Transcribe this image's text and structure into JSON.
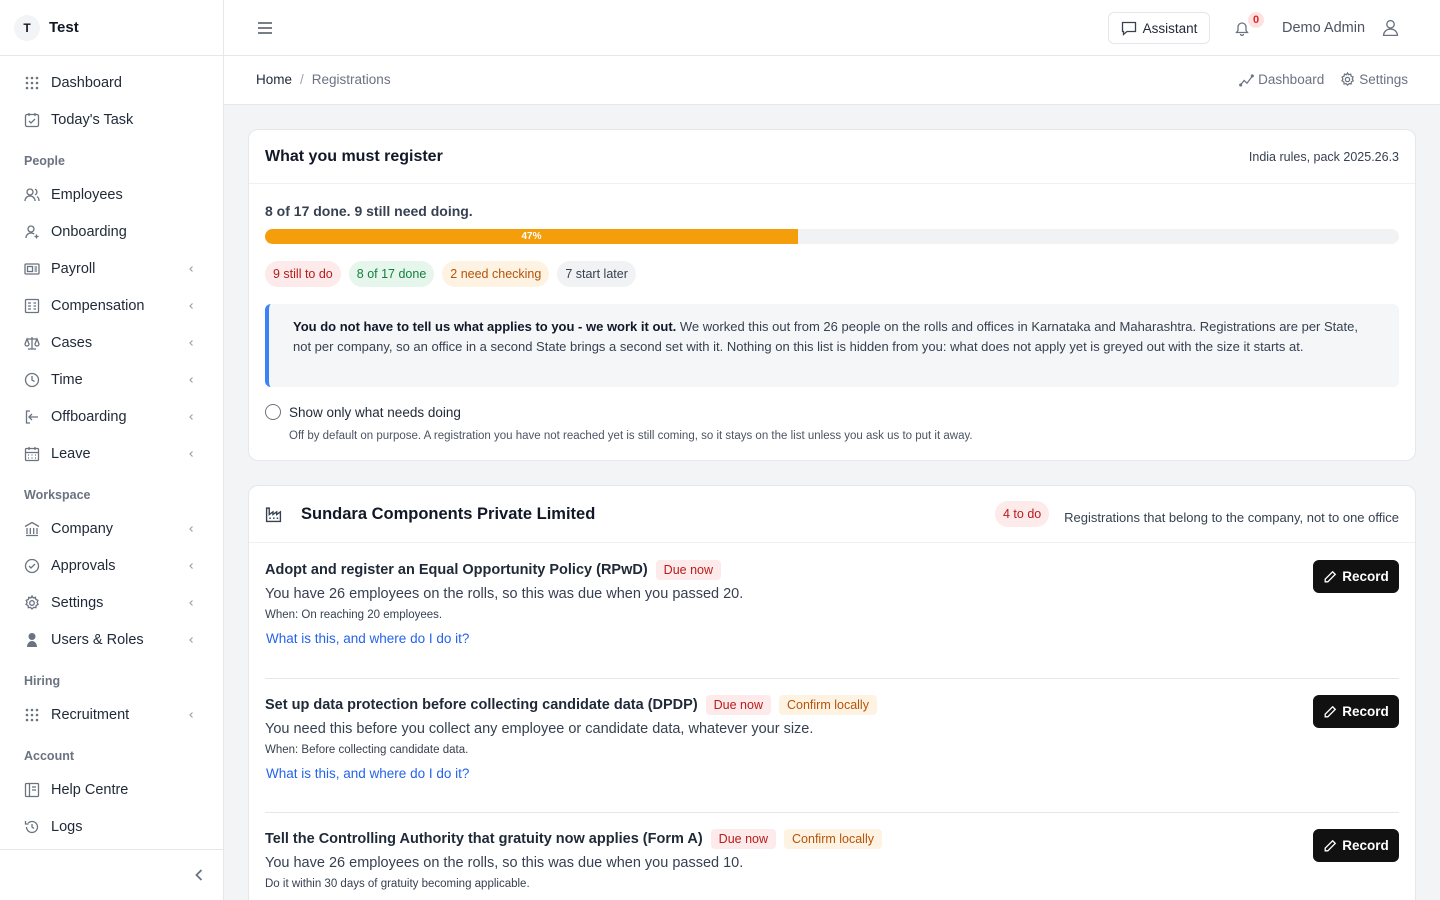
{
  "brand": {
    "initial": "T",
    "name": "Test"
  },
  "sidebar": {
    "items": [
      {
        "label": "Dashboard",
        "icon": "grid-icon"
      },
      {
        "label": "Today's Task",
        "icon": "calendar-check-icon"
      }
    ],
    "sections": [
      {
        "title": "People",
        "items": [
          {
            "label": "Employees",
            "icon": "users-icon"
          },
          {
            "label": "Onboarding",
            "icon": "user-plus-icon"
          },
          {
            "label": "Payroll",
            "icon": "payroll-icon"
          },
          {
            "label": "Compensation",
            "icon": "compensation-icon"
          },
          {
            "label": "Cases",
            "icon": "scale-icon"
          },
          {
            "label": "Time",
            "icon": "clock-icon"
          },
          {
            "label": "Offboarding",
            "icon": "logout-icon"
          },
          {
            "label": "Leave",
            "icon": "calendar-icon"
          }
        ]
      },
      {
        "title": "Workspace",
        "items": [
          {
            "label": "Company",
            "icon": "building-icon"
          },
          {
            "label": "Approvals",
            "icon": "check-circle-icon"
          },
          {
            "label": "Settings",
            "icon": "gear-icon"
          },
          {
            "label": "Users & Roles",
            "icon": "user-shield-icon"
          }
        ]
      },
      {
        "title": "Hiring",
        "items": [
          {
            "label": "Recruitment",
            "icon": "grid-icon"
          }
        ]
      },
      {
        "title": "Account",
        "items": [
          {
            "label": "Help Centre",
            "icon": "help-book-icon"
          },
          {
            "label": "Logs",
            "icon": "history-icon"
          }
        ]
      }
    ]
  },
  "topbar": {
    "assistant_label": "Assistant",
    "notification_count": "0",
    "user_name": "Demo Admin"
  },
  "breadcrumb": {
    "home": "Home",
    "separator": "/",
    "current": "Registrations",
    "actions": {
      "dashboard": "Dashboard",
      "settings": "Settings"
    }
  },
  "overview": {
    "title": "What you must register",
    "meta": "India rules, pack 2025.26.3",
    "summary": "8 of 17 done. 9 still need doing.",
    "progress": {
      "percent": 47,
      "label": "47%"
    },
    "pills": {
      "todo": "9 still to do",
      "done": "8 of 17 done",
      "check": "2 need checking",
      "later": "7 start later"
    },
    "callout": {
      "bold": "You do not have to tell us what applies to you - we work it out.",
      "text": " We worked this out from 26 people on the rolls and offices in Karnataka and Maharashtra. Registrations are per State, not per company, so an office in a second State brings a second set with it. Nothing on this list is hidden from you: what does not apply yet is greyed out with the size it starts at."
    },
    "toggle_label": "Show only what needs doing",
    "toggle_help": "Off by default on purpose. A registration you have not reached yet is still coming, so it stays on the list unless you ask us to put it away."
  },
  "company": {
    "name": "Sundara Components Private Limited",
    "todo_badge": "4 to do",
    "note": "Registrations that belong to the company, not to one office",
    "tasks": [
      {
        "title": "Adopt and register an Equal Opportunity Policy (RPwD)",
        "tag_due": "Due now",
        "desc": "You have 26 employees on the rolls, so this was due when you passed 20.",
        "when": "When: On reaching 20 employees.",
        "link": "What is this, and where do I do it?",
        "button": "Record"
      },
      {
        "title": "Set up data protection before collecting candidate data (DPDP)",
        "tag_due": "Due now",
        "tag_confirm": "Confirm locally",
        "desc": "You need this before you collect any employee or candidate data, whatever your size.",
        "when": "When: Before collecting candidate data.",
        "link": "What is this, and where do I do it?",
        "button": "Record"
      },
      {
        "title": "Tell the Controlling Authority that gratuity now applies (Form A)",
        "tag_due": "Due now",
        "tag_confirm": "Confirm locally",
        "desc": "You have 26 employees on the rolls, so this was due when you passed 10.",
        "when": "Do it within 30 days of gratuity becoming applicable.",
        "button": "Record"
      }
    ]
  },
  "colors": {
    "accent": "#f59e0b",
    "callout_border": "#3b82f6",
    "due_text": "#b91c1c",
    "confirm_text": "#b45309",
    "done_text": "#15803d",
    "link": "#2563eb"
  }
}
